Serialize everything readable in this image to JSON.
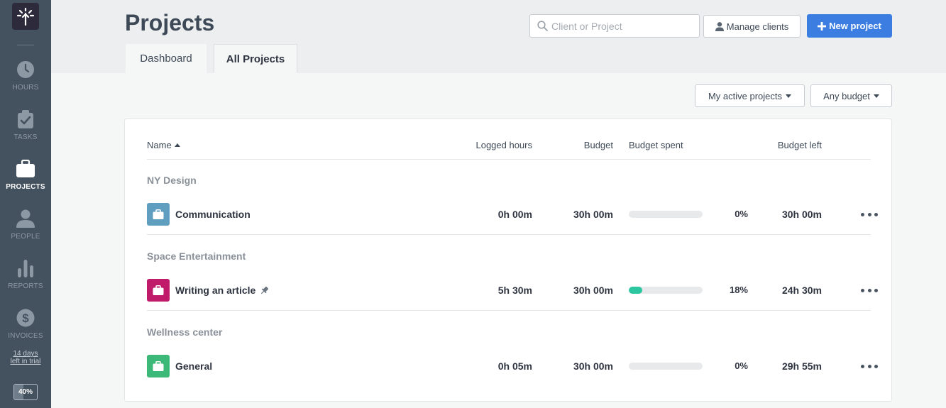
{
  "sidebar": {
    "items": [
      {
        "label": "HOURS",
        "icon": "clock-icon"
      },
      {
        "label": "TASKS",
        "icon": "clipboard-check-icon"
      },
      {
        "label": "PROJECTS",
        "icon": "briefcase-icon"
      },
      {
        "label": "PEOPLE",
        "icon": "person-icon"
      },
      {
        "label": "REPORTS",
        "icon": "bar-chart-icon"
      },
      {
        "label": "INVOICES",
        "icon": "dollar-icon"
      }
    ],
    "trial_line1": "14 days",
    "trial_line2": "left in trial",
    "progress_label": "40%",
    "progress_value": 0.4
  },
  "header": {
    "title": "Projects",
    "search_placeholder": "Client or Project",
    "manage_label": "Manage clients",
    "new_label": "New project",
    "tabs": [
      {
        "label": "Dashboard"
      },
      {
        "label": "All Projects"
      }
    ]
  },
  "filters": {
    "active": "My active projects",
    "budget": "Any budget"
  },
  "table": {
    "headers": {
      "name": "Name",
      "hours": "Logged hours",
      "budget": "Budget",
      "spent": "Budget spent",
      "left": "Budget left"
    },
    "groups": [
      {
        "client": "NY Design",
        "project": {
          "name": "Communication",
          "color": "#5f9ebf",
          "hours": "0h 00m",
          "budget": "30h 00m",
          "spent_pct": "0%",
          "spent_fraction": 0,
          "left": "30h 00m",
          "pinned": false
        }
      },
      {
        "client": "Space Entertainment",
        "project": {
          "name": "Writing an article",
          "color": "#bf1b6a",
          "hours": "5h 30m",
          "budget": "30h 00m",
          "spent_pct": "18%",
          "spent_fraction": 0.18,
          "left": "24h 30m",
          "pinned": true
        }
      },
      {
        "client": "Wellness center",
        "project": {
          "name": "General",
          "color": "#3cb878",
          "hours": "0h 05m",
          "budget": "30h 00m",
          "spent_pct": "0%",
          "spent_fraction": 0,
          "left": "29h 55m",
          "pinned": false
        }
      }
    ]
  },
  "colors": {
    "accent": "#3b7de0",
    "sidebar": "#44515f",
    "progress": "#2cc7a0"
  }
}
